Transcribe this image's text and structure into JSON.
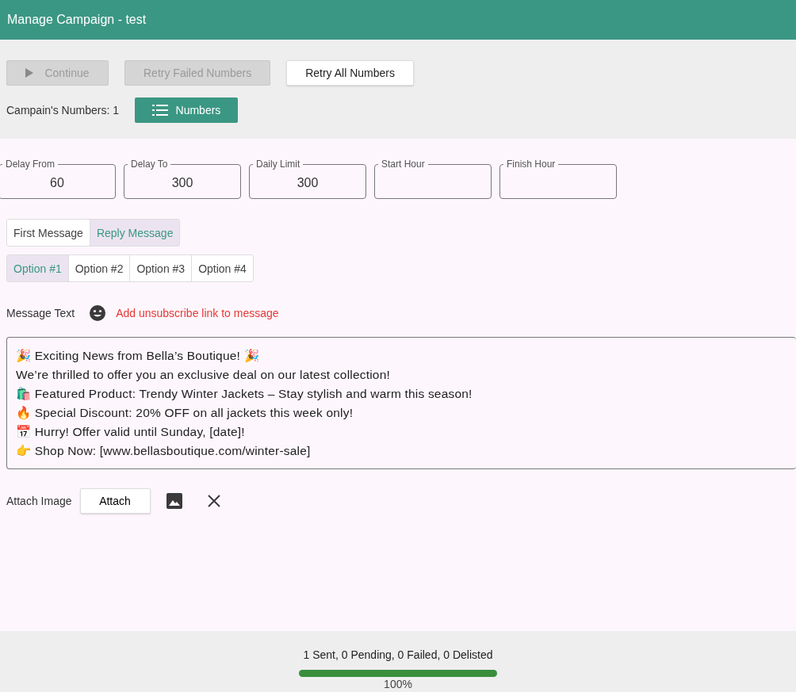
{
  "window": {
    "title": "Manage Campaign - test"
  },
  "actions": [
    {
      "label": "Continue",
      "disabled": true
    },
    {
      "label": "Retry Failed Numbers",
      "disabled": true
    },
    {
      "label": "Retry All Numbers",
      "disabled": false
    }
  ],
  "numbers": {
    "label": "Campain's Numbers: 1",
    "button": "Numbers"
  },
  "fields": [
    {
      "label": "Delay From",
      "value": "60"
    },
    {
      "label": "Delay To",
      "value": "300"
    },
    {
      "label": "Daily Limit",
      "value": "300"
    },
    {
      "label": "Start Hour"
    },
    {
      "label": "Finish Hour"
    }
  ],
  "message_tabs": [
    {
      "label": "First Message",
      "selected": false
    },
    {
      "label": "Reply Message",
      "selected": true
    }
  ],
  "option_tabs": [
    {
      "label": "Option #1",
      "selected": true
    },
    {
      "label": "Option #2",
      "selected": false
    },
    {
      "label": "Option #3",
      "selected": false
    },
    {
      "label": "Option #4",
      "selected": false
    }
  ],
  "message": {
    "label": "Message Text",
    "unsubscribe_link": "Add unsubscribe link to message",
    "lines": [
      "🎉 Exciting News from Bella’s Boutique! 🎉",
      "We’re thrilled to offer you an exclusive deal on our latest collection!",
      "🛍️ Featured Product: Trendy Winter Jackets – Stay stylish and warm this season!",
      "🔥 Special Discount: 20% OFF on all jackets this week only!",
      "📅 Hurry! Offer valid until Sunday, [date]!",
      "👉 Shop Now: [www.bellasboutique.com/winter-sale]"
    ]
  },
  "attach": {
    "label": "Attach Image",
    "button": "Attach"
  },
  "status": {
    "summary": "1 Sent, 0 Pending, 0 Failed, 0 Delisted",
    "level": 1,
    "reading": "100%"
  }
}
